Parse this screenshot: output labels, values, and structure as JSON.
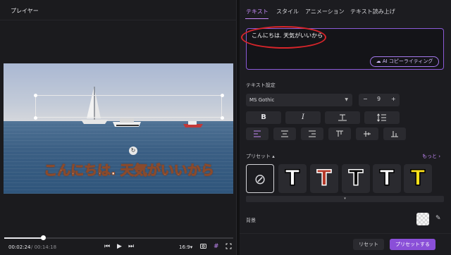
{
  "player": {
    "title": "プレイヤー",
    "subtitle_text": "こんにちは. 天気がいいから",
    "time_current": "00:02:24",
    "time_total": "/ 00:14:18",
    "progress_fraction": 0.17,
    "aspect_ratio": "16:9",
    "controls": {
      "prev": "⏮",
      "play": "▶",
      "next": "⏭",
      "aspect_chev": "▾",
      "snapshot": "📷",
      "grid": "#",
      "fullscreen": "⛶"
    }
  },
  "tabs": [
    {
      "label": "テキスト",
      "active": true
    },
    {
      "label": "スタイル",
      "active": false
    },
    {
      "label": "アニメーション",
      "active": false
    },
    {
      "label": "テキスト読み上げ",
      "active": false
    }
  ],
  "text_editor": {
    "value": "こんにちは. 天気がいいから",
    "ai_button": "AI コピーライティング"
  },
  "text_settings": {
    "section_label": "テキスト設定",
    "font": "MS Gothic",
    "font_size": "9",
    "minus": "−",
    "plus": "+",
    "format_buttons": {
      "bold": "B",
      "italic": "I",
      "char_spacing": "T",
      "line_spacing": "‡"
    },
    "align_buttons": {
      "left": "≡",
      "center": "≡",
      "right": "≡",
      "top": "⊥",
      "middle": "⊥",
      "bottom": "⊥"
    }
  },
  "presets": {
    "label": "プリセット ▴",
    "more_link": "もっと ›",
    "none_symbol": "⊘",
    "glyph": "T",
    "items": [
      {
        "color": "#ffffff",
        "stroke": "#000000"
      },
      {
        "color": "#b53a2a",
        "stroke": "#ffffff"
      },
      {
        "color": "#000000",
        "stroke": "#ffffff"
      },
      {
        "color": "#ffffff",
        "stroke": "#000000"
      },
      {
        "color": "#ffe11a",
        "stroke": "#000000"
      }
    ],
    "expand_chev": "▾"
  },
  "background": {
    "label": "背景",
    "eyedropper": "✎"
  },
  "footer": {
    "reset": "リセット",
    "save_preset": "プリセットする"
  },
  "colors": {
    "accent": "#c58af9",
    "annotation": "#d8252a"
  }
}
